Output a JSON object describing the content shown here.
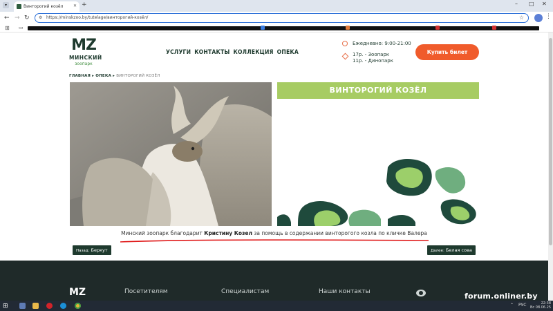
{
  "browser": {
    "tab_title": "Винторогий козёл",
    "new_tab": "+",
    "url": "https://minskzoo.by/tutelage/винторогий-козёл/"
  },
  "site": {
    "logo_mark": "MZ",
    "logo_title": "МИНСКИЙ",
    "logo_sub": "зоопарк",
    "nav": [
      "УСЛУГИ",
      "КОНТАКТЫ",
      "КОЛЛЕКЦИЯ",
      "ОПЕКА"
    ],
    "hours": "Ежедневно: 9:00-21:00",
    "location_1": "17р. - Зоопарк",
    "location_2": "11р. - Динопарк",
    "buy_button": "Купить билет"
  },
  "breadcrumbs": {
    "home": "ГЛАВНАЯ",
    "sep1": "▸",
    "section": "ОПЕКА",
    "sep2": "▸",
    "current": "ВИНТОРОГИЙ КОЗЁЛ"
  },
  "animal": {
    "title": "ВИНТОРОГИЙ КОЗЁЛ",
    "thanks_prefix": "Минский зоопарк благодарит",
    "thanks_name": "Кристину Козел",
    "thanks_suffix": "за помощь в содержании винторогого козла по кличке Валера"
  },
  "pager": {
    "prev_label": "Назад:",
    "prev_name": "Беркут",
    "next_label": "Далее:",
    "next_name": "Белая сова"
  },
  "footer": {
    "logo": "MZ",
    "col1": "Посетителям",
    "col2": "Специалистам",
    "col3": "Наши контакты"
  },
  "watermark": "forum.onliner.by",
  "taskbar": {
    "lang": "РУС",
    "time": "22:38",
    "date": "Вс 08.06.25"
  },
  "colors": {
    "brand_dark": "#1e3a2e",
    "accent_orange": "#f05b2b",
    "title_green": "#a7cc63"
  }
}
